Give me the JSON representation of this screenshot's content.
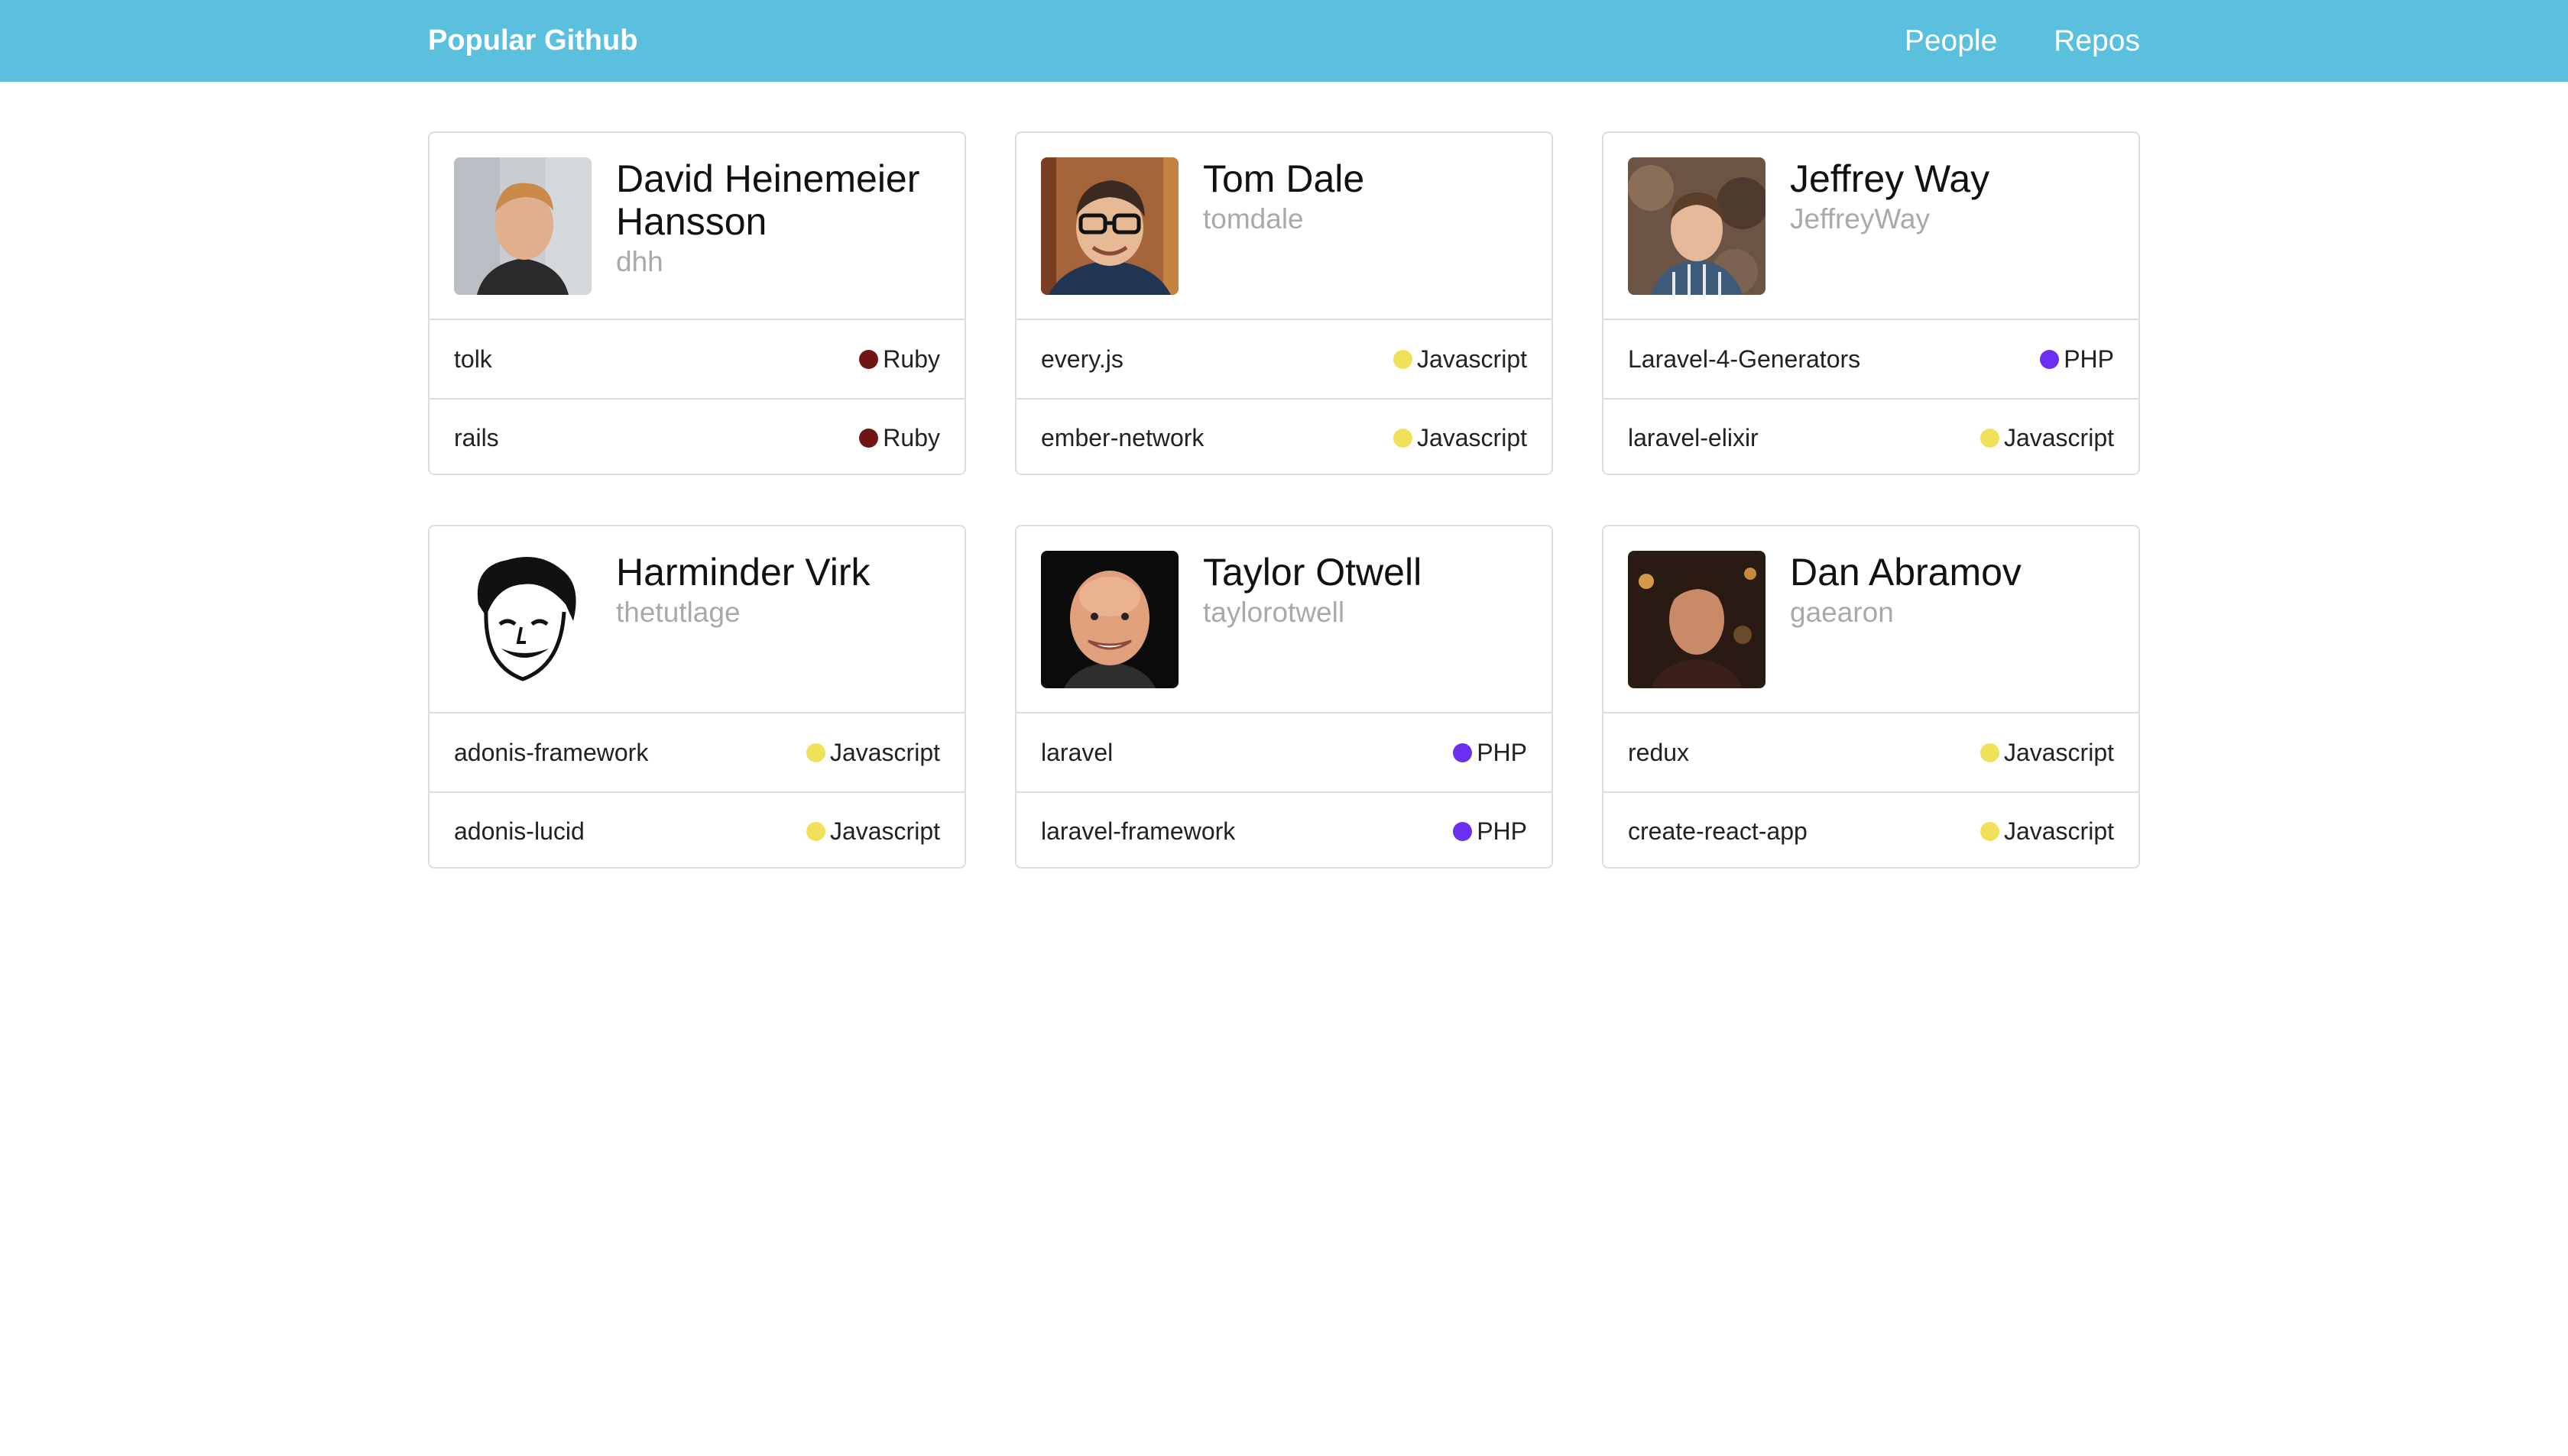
{
  "header": {
    "brand": "Popular Github",
    "nav": [
      {
        "label": "People"
      },
      {
        "label": "Repos"
      }
    ],
    "background": "#5bc0de"
  },
  "languages": {
    "Ruby": "#701516",
    "Javascript": "#f1e05a",
    "PHP": "#6a2ff0"
  },
  "people": [
    {
      "name": "David Heinemeier Hansson",
      "login": "dhh",
      "repos": [
        {
          "name": "tolk",
          "language": "Ruby",
          "color": "#701516"
        },
        {
          "name": "rails",
          "language": "Ruby",
          "color": "#701516"
        }
      ]
    },
    {
      "name": "Tom Dale",
      "login": "tomdale",
      "repos": [
        {
          "name": "every.js",
          "language": "Javascript",
          "color": "#f1e05a"
        },
        {
          "name": "ember-network",
          "language": "Javascript",
          "color": "#f1e05a"
        }
      ]
    },
    {
      "name": "Jeffrey Way",
      "login": "JeffreyWay",
      "repos": [
        {
          "name": "Laravel-4-Generators",
          "language": "PHP",
          "color": "#6a2ff0"
        },
        {
          "name": "laravel-elixir",
          "language": "Javascript",
          "color": "#f1e05a"
        }
      ]
    },
    {
      "name": "Harminder Virk",
      "login": "thetutlage",
      "repos": [
        {
          "name": "adonis-framework",
          "language": "Javascript",
          "color": "#f1e05a"
        },
        {
          "name": "adonis-lucid",
          "language": "Javascript",
          "color": "#f1e05a"
        }
      ]
    },
    {
      "name": "Taylor Otwell",
      "login": "taylorotwell",
      "repos": [
        {
          "name": "laravel",
          "language": "PHP",
          "color": "#6a2ff0"
        },
        {
          "name": "laravel-framework",
          "language": "PHP",
          "color": "#6a2ff0"
        }
      ]
    },
    {
      "name": "Dan Abramov",
      "login": "gaearon",
      "repos": [
        {
          "name": "redux",
          "language": "Javascript",
          "color": "#f1e05a"
        },
        {
          "name": "create-react-app",
          "language": "Javascript",
          "color": "#f1e05a"
        }
      ]
    }
  ]
}
